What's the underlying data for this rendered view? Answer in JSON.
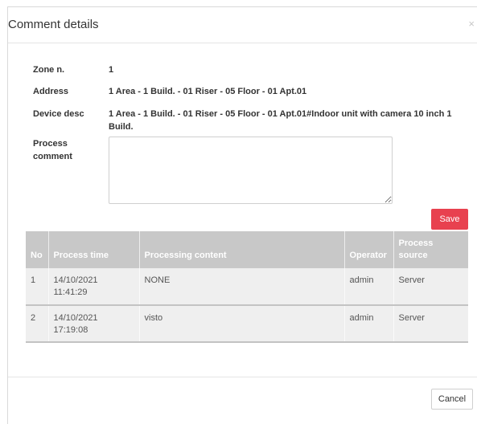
{
  "dialog": {
    "title": "Comment details",
    "close": "×"
  },
  "fields": {
    "zone_label": "Zone n.",
    "zone_value": "1",
    "address_label": "Address",
    "address_value": "1 Area - 1 Build. - 01 Riser - 05 Floor - 01 Apt.01",
    "device_label": "Device desc",
    "device_value_line1": "1 Area - 1 Build. - 01 Riser - 05 Floor - 01 Apt.01#Indoor unit with camera 10 inch 1",
    "device_value_line2": "Build.",
    "comment_label_line1": "Process",
    "comment_label_line2": "comment",
    "comment_value": ""
  },
  "buttons": {
    "save": "Save",
    "cancel": "Cancel"
  },
  "table": {
    "headers": {
      "no": "No",
      "time": "Process time",
      "content": "Processing content",
      "operator": "Operator",
      "source_line1": "Process",
      "source_line2": "source"
    },
    "rows": [
      {
        "no": "1",
        "date": "14/10/2021",
        "time": "11:41:29",
        "content": "NONE",
        "operator": "admin",
        "source": "Server"
      },
      {
        "no": "2",
        "date": "14/10/2021",
        "time": "17:19:08",
        "content": "visto",
        "operator": "admin",
        "source": "Server"
      }
    ]
  }
}
